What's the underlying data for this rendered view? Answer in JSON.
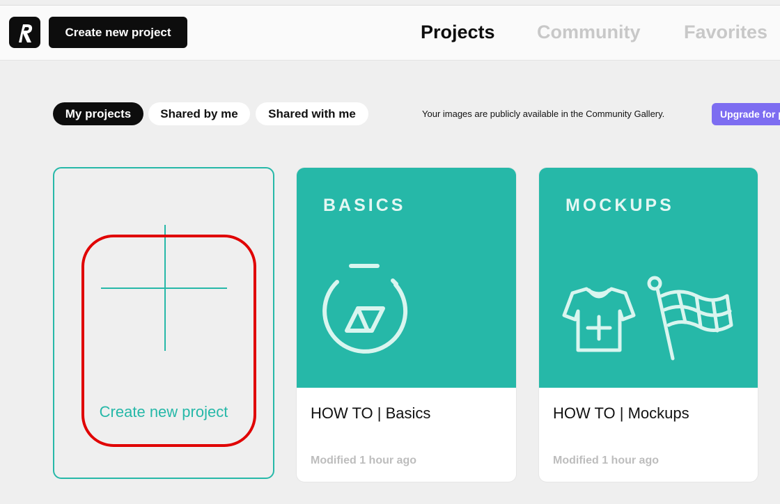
{
  "header": {
    "create_label": "Create new project",
    "nav": {
      "projects": "Projects",
      "community": "Community",
      "favorites": "Favorites"
    }
  },
  "filters": {
    "my": "My projects",
    "shared_by": "Shared by me",
    "shared_with": "Shared with me"
  },
  "notice": "Your images are publicly available in the Community Gallery.",
  "upgrade_label": "Upgrade for p",
  "new_project": {
    "label": "Create new project"
  },
  "cards": [
    {
      "thumb_title": "BASICS",
      "title": "HOW TO | Basics",
      "meta": "Modified 1 hour ago",
      "icon": "stopwatch-logo-icon"
    },
    {
      "thumb_title": "MOCKUPS",
      "title": "HOW TO | Mockups",
      "meta": "Modified 1 hour ago",
      "icon": "tshirt-flag-icon"
    }
  ],
  "colors": {
    "accent": "#26b8a8",
    "upgrade": "#7d6df1",
    "highlight": "#e00000",
    "dark": "#0d0d0d"
  }
}
